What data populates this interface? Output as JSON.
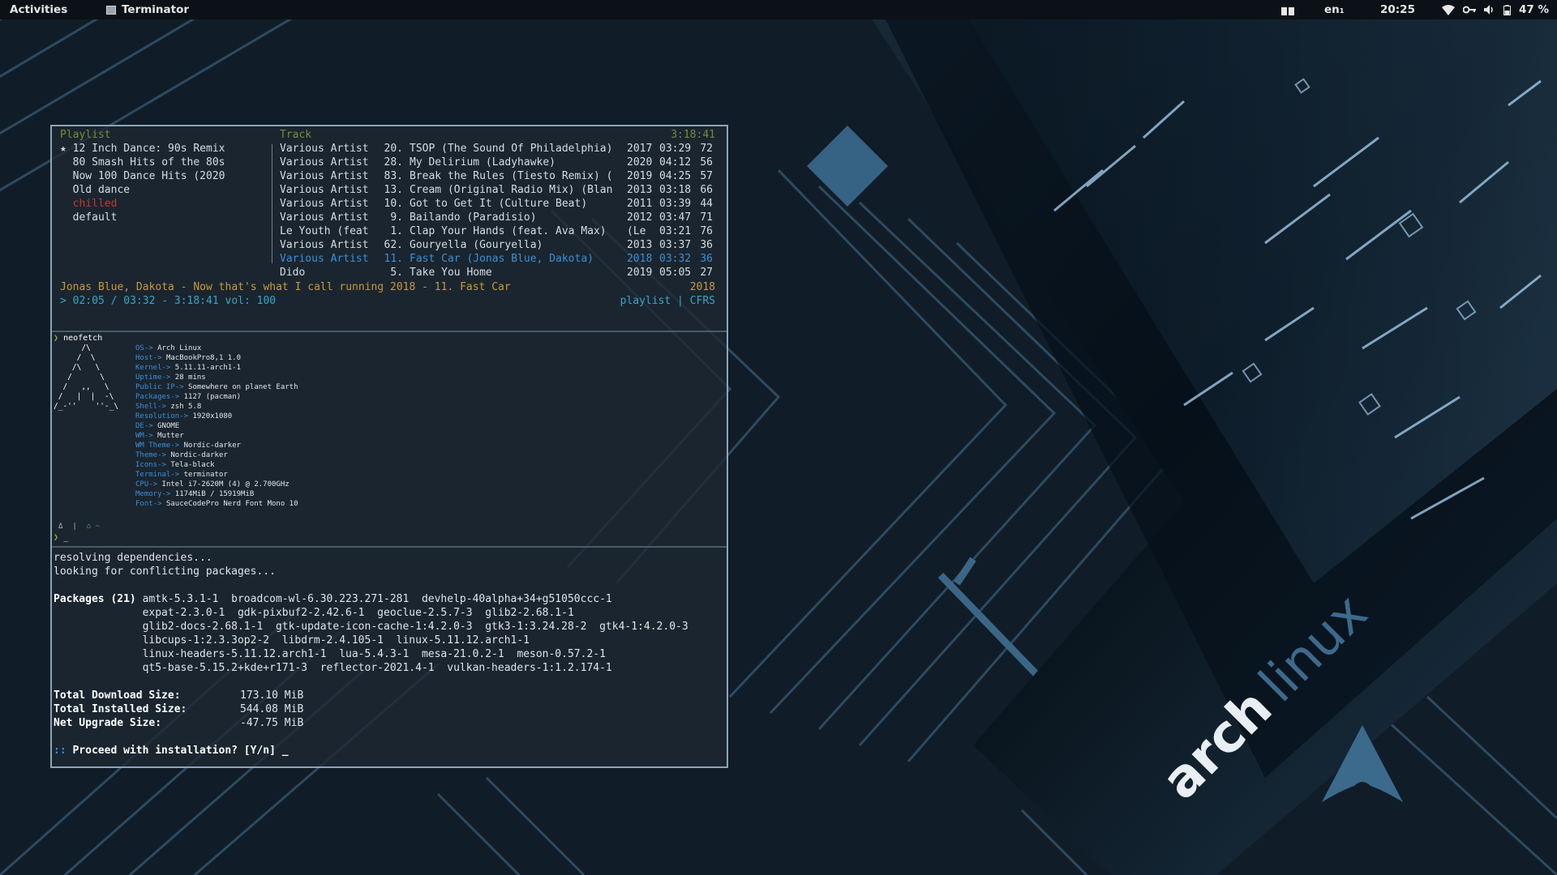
{
  "topbar": {
    "activities": "Activities",
    "app_name": "Terminator",
    "language": "en₁",
    "time": "20:25",
    "battery": "47 %",
    "icons": [
      "workspace-icon",
      "wifi-icon",
      "key-icon",
      "volume-icon",
      "battery-icon"
    ]
  },
  "wallpaper": {
    "brand": "archlinux",
    "colors": {
      "base": "#0e1a24",
      "accent": "#3b6f95",
      "light": "#9fc7e6"
    }
  },
  "music": {
    "playlist_header": "Playlist",
    "track_header": "Track",
    "total_time": "3:18:41",
    "playlists": [
      {
        "label": "★ 12 Inch Dance: 90s Remix",
        "active": false
      },
      {
        "label": "  80 Smash Hits of the 80s",
        "active": false
      },
      {
        "label": "  Now 100 Dance Hits (2020",
        "active": false
      },
      {
        "label": "  Old dance",
        "active": false
      },
      {
        "label": "  chilled",
        "active": true
      },
      {
        "label": "  default",
        "active": false
      }
    ],
    "tracks": [
      {
        "artist": "Various Artist",
        "num": "20.",
        "title": "TSOP (The Sound Of Philadelphia)",
        "year": "2017",
        "duration": "03:29",
        "count": "72",
        "playing": false
      },
      {
        "artist": "Various Artist",
        "num": "28.",
        "title": "My Delirium (Ladyhawke)",
        "year": "2020",
        "duration": "04:12",
        "count": "56",
        "playing": false
      },
      {
        "artist": "Various Artist",
        "num": "83.",
        "title": "Break the Rules (Tiesto Remix) (",
        "year": "2019",
        "duration": "04:25",
        "count": "57",
        "playing": false
      },
      {
        "artist": "Various Artist",
        "num": "13.",
        "title": "Cream (Original Radio Mix) (Blan",
        "year": "2013",
        "duration": "03:18",
        "count": "66",
        "playing": false
      },
      {
        "artist": "Various Artist",
        "num": "10.",
        "title": "Got to Get It (Culture Beat)",
        "year": "2011",
        "duration": "03:39",
        "count": "44",
        "playing": false
      },
      {
        "artist": "Various Artist",
        "num": "9.",
        "title": "Bailando (Paradisio)",
        "year": "2012",
        "duration": "03:47",
        "count": "71",
        "playing": false
      },
      {
        "artist": "Le Youth (feat",
        "num": "1.",
        "title": "Clap Your Hands (feat. Ava Max)",
        "year": "(Le",
        "duration": "03:21",
        "count": "76",
        "playing": false
      },
      {
        "artist": "Various Artist",
        "num": "62.",
        "title": "Gouryella (Gouryella)",
        "year": "2013",
        "duration": "03:37",
        "count": "36",
        "playing": false
      },
      {
        "artist": "Various Artist",
        "num": "11.",
        "title": "Fast Car (Jonas Blue, Dakota)",
        "year": "2018",
        "duration": "03:32",
        "count": "36",
        "playing": true
      },
      {
        "artist": "Dido",
        "num": "5.",
        "title": "Take You Home",
        "year": "2019",
        "duration": "05:05",
        "count": "27",
        "playing": false
      }
    ],
    "now_playing": "Jonas Blue, Dakota - Now that's what I call running 2018 - 11. Fast Car",
    "now_playing_year": "2018",
    "status": "> 02:05 / 03:32 - 3:18:41 vol: 100",
    "status_right": "playlist | CFRS"
  },
  "neofetch": {
    "prompt_symbol": "❯",
    "command": "neofetch",
    "logo": "      /\\\n     /  \\\n    /\\   \\\n   /      \\\n  /   ,,   \\\n /   |  |  -\\\n/_-''    ''-_\\",
    "info": [
      {
        "key": "OS",
        "value": "Arch Linux"
      },
      {
        "key": "Host",
        "value": "MacBookPro8,1 1.0"
      },
      {
        "key": "Kernel",
        "value": "5.11.11-arch1-1"
      },
      {
        "key": "Uptime",
        "value": "28 mins"
      },
      {
        "key": "Public IP",
        "value": "Somewhere on planet Earth"
      },
      {
        "key": "Packages",
        "value": "1127 (pacman)"
      },
      {
        "key": "Shell",
        "value": "zsh 5.8"
      },
      {
        "key": "Resolution",
        "value": "1920x1080"
      },
      {
        "key": "DE",
        "value": "GNOME"
      },
      {
        "key": "WM",
        "value": "Mutter"
      },
      {
        "key": "WM Theme",
        "value": "Nordic-darker"
      },
      {
        "key": "Theme",
        "value": "Nordic-darker"
      },
      {
        "key": "Icons",
        "value": "Tela-black"
      },
      {
        "key": "Terminal",
        "value": "terminator"
      },
      {
        "key": "CPU",
        "value": "Intel i7-2620M (4) @ 2.700GHz"
      },
      {
        "key": "Memory",
        "value": "1174MiB / 15919MiB"
      },
      {
        "key": "Font",
        "value": "SauceCodePro Nerd Font Mono 10"
      }
    ],
    "separator": "->",
    "bar_left": "Δ",
    "bar_home": "⌂ ~",
    "cursor": "_"
  },
  "pacman": {
    "lines": [
      "resolving dependencies...",
      "looking for conflicting packages..."
    ],
    "packages_label": "Packages (21)",
    "package_lines": [
      "amtk-5.3.1-1  broadcom-wl-6.30.223.271-281  devhelp-40alpha+34+g51050ccc-1",
      "expat-2.3.0-1  gdk-pixbuf2-2.42.6-1  geoclue-2.5.7-3  glib2-2.68.1-1",
      "glib2-docs-2.68.1-1  gtk-update-icon-cache-1:4.2.0-3  gtk3-1:3.24.28-2  gtk4-1:4.2.0-3",
      "libcups-1:2.3.3op2-2  libdrm-2.4.105-1  linux-5.11.12.arch1-1",
      "linux-headers-5.11.12.arch1-1  lua-5.4.3-1  mesa-21.0.2-1  meson-0.57.2-1",
      "qt5-base-5.15.2+kde+r171-3  reflector-2021.4-1  vulkan-headers-1:1.2.174-1"
    ],
    "sizes": [
      {
        "label": "Total Download Size:",
        "value": "173.10 MiB"
      },
      {
        "label": "Total Installed Size:",
        "value": "544.08 MiB"
      },
      {
        "label": "Net Upgrade Size:",
        "value": "-47.75 MiB"
      }
    ],
    "prompt_prefix": "::",
    "prompt": "Proceed with installation? [Y/n] _"
  }
}
